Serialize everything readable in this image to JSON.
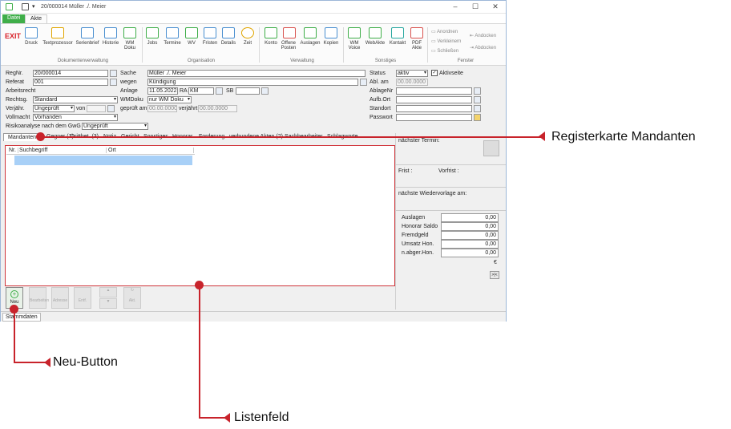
{
  "window": {
    "title": "20/000014 Müller ./. Meier"
  },
  "ribbon_tabs": [
    "Datei",
    "Akte"
  ],
  "ribbon": {
    "exit": "EXIT",
    "doc_buttons": [
      "Druck",
      "Textprozessor",
      "Serienbrief",
      "Historie",
      "WM Doku"
    ],
    "doc_group": "Dokumentenverwaltung",
    "org_buttons": [
      "Jobs",
      "Termine",
      "WV",
      "Fristen",
      "Details",
      "Zeit"
    ],
    "org_group": "Organisation",
    "verw_buttons": [
      "Konto",
      "Offene Posten",
      "Auslagen",
      "Kopien"
    ],
    "verw_group": "Verwaltung",
    "sonst_buttons": [
      "WM Voice",
      "WebAkte",
      "Kontakt",
      "PDF Akte"
    ],
    "sonst_group": "Sonstiges",
    "fenster_items": [
      "Anordnen",
      "Verkleinern",
      "Schließen",
      "Andocken",
      "Abdocken"
    ],
    "fenster_group": "Fenster"
  },
  "form": {
    "regnr_label": "RegNr.",
    "regnr": "20/000014",
    "referat_label": "Referat",
    "referat": "001",
    "arbeitsrecht_label": "Arbeitsrecht",
    "rechtsg_label": "Rechtsg.",
    "rechtsg": "Standard",
    "verjaehr_label": "Verjähr.",
    "verjaehr": "Ungeprüft",
    "von_label": "von",
    "vollmacht_label": "Vollmacht",
    "vollmacht": "Vorhanden",
    "risiko_label": "Risikoanalyse nach dem GwG",
    "risiko": "Ungeprüft",
    "sache_label": "Sache",
    "sache": "Müller ./. Meier",
    "wegen_label": "wegen",
    "wegen": "Kündigung",
    "anlage_label": "Anlage",
    "anlage": "11.05.2022",
    "ra_label": "RA",
    "ra": "KM",
    "sb_label": "SB",
    "wmdoku_label": "WMDoku",
    "wmdoku": "nur WM Doku",
    "geprueft_label": "geprüft am",
    "geprueft": "00.00.0000",
    "verjaehrt_label": "verjährt",
    "verjaehrt": "00.00.0000",
    "status_label": "Status",
    "status": "aktiv",
    "ablam_label": "Abl. am",
    "ablam": "00.00.0000",
    "aktivseite_label": "Aktivseite",
    "ablagenr_label": "AblageNr",
    "aufbort_label": "Aufb.Ort",
    "standort_label": "Standort",
    "passwort_label": "Passwort"
  },
  "tabs": [
    "Mandanten",
    "Gegner (1)",
    "Drittbet. (3)",
    "Notiz",
    "Gericht",
    "Sonstiges",
    "Honorar",
    "Forderung",
    "verbundene Akten (2)",
    "Sachbearbeiter",
    "Schlagworte"
  ],
  "list": {
    "headers": [
      "Nr.",
      "Suchbegriff",
      "Ort"
    ]
  },
  "right_panel": {
    "naechster_termin": "nächster Termin:",
    "frist": "Frist :",
    "vorfrist": "Vorfrist :",
    "wiedervorlage": "nächste Wiedervorlage am:",
    "rows": [
      {
        "label": "Auslagen",
        "value": "0,00"
      },
      {
        "label": "Honorar Saldo",
        "value": "0,00"
      },
      {
        "label": "Fremdgeld",
        "value": "0,00"
      },
      {
        "label": "Umsatz Hon.",
        "value": "0,00"
      },
      {
        "label": "n.abger.Hon.",
        "value": "0,00"
      }
    ],
    "currency": "€",
    "nav": ">|<"
  },
  "bottom_buttons": [
    "Neu",
    "Bearbeiten",
    "Adresse",
    "Entf.",
    "",
    "",
    "Akt."
  ],
  "status_tab": "Stammdaten",
  "callouts": {
    "registerkarte": "Registerkarte Mandanten",
    "neu": "Neu-Button",
    "listenfeld": "Listenfeld"
  },
  "accent": "#c8232b"
}
